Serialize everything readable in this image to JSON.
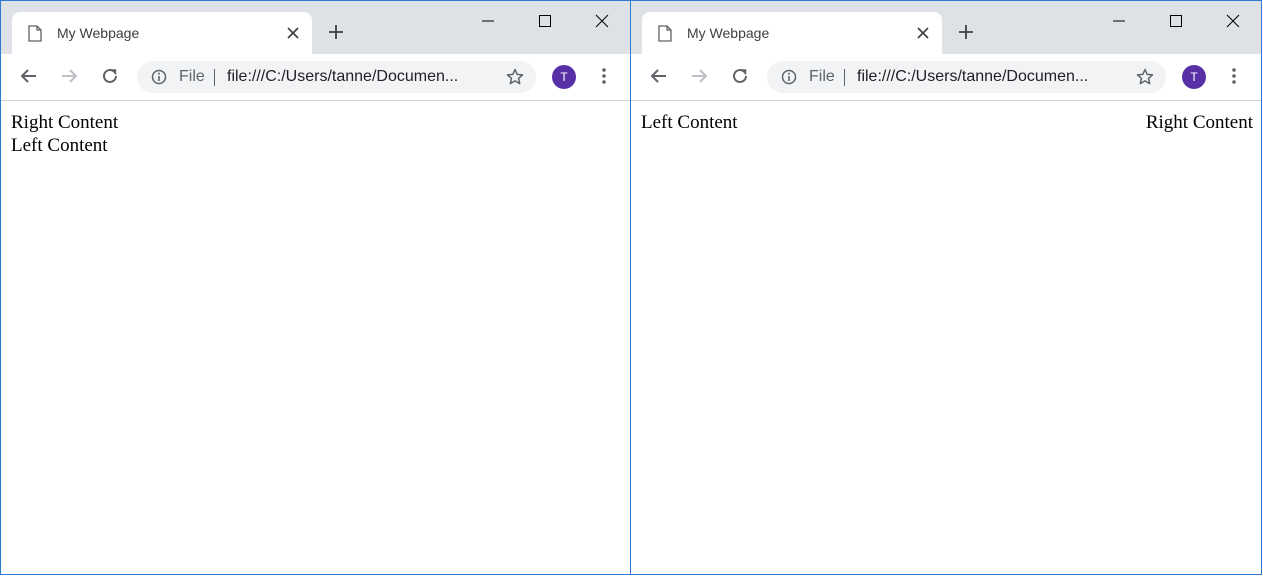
{
  "windows": [
    {
      "tab": {
        "title": "My Webpage"
      },
      "omnibox": {
        "scheme_label": "File",
        "url": "file:///C:/Users/tanne/Documen..."
      },
      "profile": {
        "initial": "T"
      },
      "page": {
        "first": "Right Content",
        "second": "Left Content"
      }
    },
    {
      "tab": {
        "title": "My Webpage"
      },
      "omnibox": {
        "scheme_label": "File",
        "url": "file:///C:/Users/tanne/Documen..."
      },
      "profile": {
        "initial": "T"
      },
      "page": {
        "left": "Left Content",
        "right": "Right Content"
      }
    }
  ],
  "colors": {
    "tabstrip": "#dee1e6",
    "omnibox": "#f1f3f4",
    "avatar": "#5730a6",
    "window_border": "#2b7bd0"
  },
  "icons": [
    "page-icon",
    "close-icon",
    "plus-icon",
    "minimize-icon",
    "maximize-icon",
    "back-icon",
    "forward-icon",
    "reload-icon",
    "info-icon",
    "star-icon",
    "kebab-menu-icon"
  ]
}
